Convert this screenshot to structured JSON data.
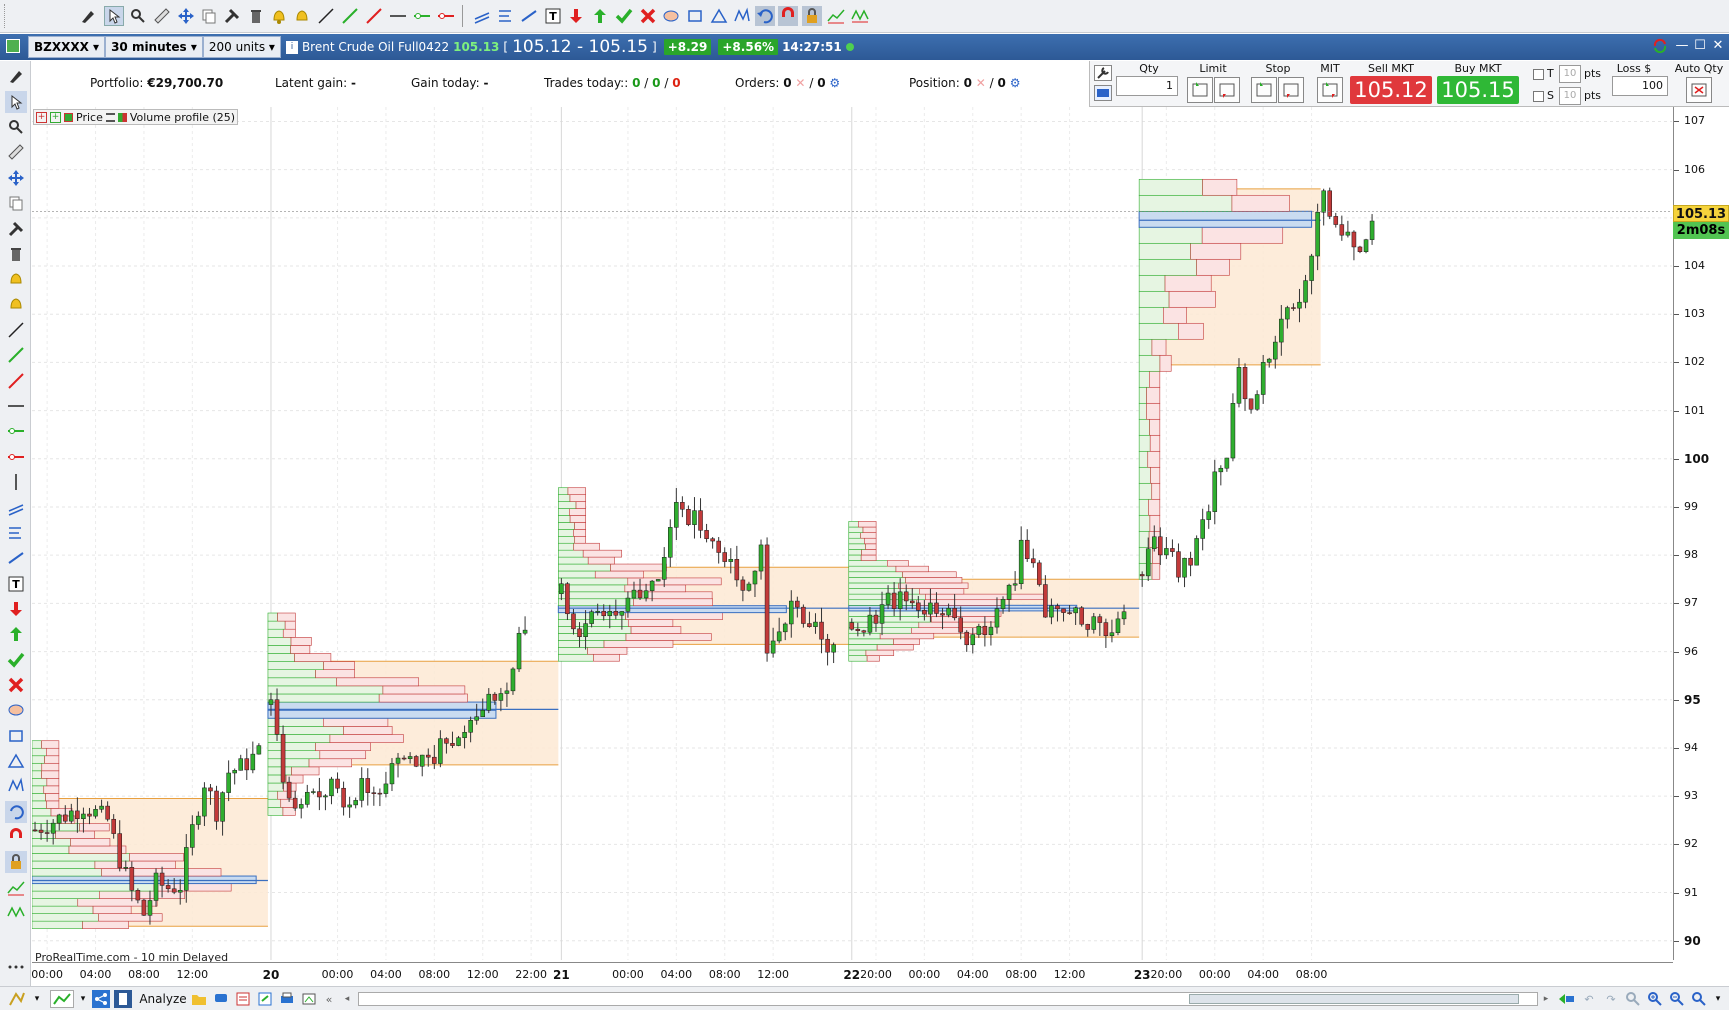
{
  "header": {
    "symbol": "BZXXXX",
    "timeframe": "30 minutes",
    "units": "200 units",
    "instrument": "Brent Crude Oil Full0422",
    "last": "105.13",
    "bracket_open": "[",
    "bid_ask": "105.12 - 105.15",
    "bracket_close": "]",
    "change": "+8.29",
    "change_pct": "+8.56%",
    "time": "14:27:51"
  },
  "portfolio": {
    "portfolio_label": "Portfolio:",
    "portfolio_value": "€29,700.70",
    "latent_label": "Latent gain:",
    "latent_value": "-",
    "gain_label": "Gain today:",
    "gain_value": "-",
    "trades_label": "Trades today::",
    "trades_a": "0",
    "trades_sep1": "/",
    "trades_b": "0",
    "trades_sep2": "/",
    "trades_c": "0",
    "orders_label": "Orders:",
    "orders_a": "0",
    "orders_sep": "/",
    "orders_b": "0",
    "position_label": "Position:",
    "position_a": "0",
    "position_sep": "/",
    "position_b": "0"
  },
  "trade_panel": {
    "qty_label": "Qty",
    "qty_value": "1",
    "limit_label": "Limit",
    "stop_label": "Stop",
    "mit_label": "MIT",
    "sell_label": "Sell MKT",
    "sell_price": "105.12",
    "buy_label": "Buy MKT",
    "buy_price": "105.15",
    "t_label": "T",
    "s_label": "S",
    "t_pts": "10",
    "s_pts": "10",
    "pts_label": "pts",
    "loss_label": "Loss $",
    "loss_value": "100",
    "autoqty_label": "Auto Qty"
  },
  "legend": {
    "price": "Price",
    "volume_profile": "Volume profile (25)"
  },
  "footer_note": "ProRealTime.com - 10 min Delayed",
  "analyze_label": "Analyze",
  "price_tag": "105.13",
  "time_tag": "2m08s",
  "colors": {
    "up": "#2fae2f",
    "down": "#c23a3a",
    "va_fill": "#fde9d4",
    "va_line": "#e8a040",
    "poc": "#3a6fc0",
    "header": "#2d5996"
  },
  "y_axis": {
    "min": 89.6,
    "max": 107.3,
    "labels": [
      "107",
      "106",
      "105",
      "104",
      "103",
      "102",
      "101",
      "100",
      "99",
      "98",
      "97",
      "96",
      "95",
      "94",
      "93",
      "92",
      "91",
      "90"
    ],
    "bold": [
      "100",
      "95",
      "90"
    ]
  },
  "x_axis": {
    "labels": [
      {
        "t": "00:00",
        "i": 2.5
      },
      {
        "t": "04:00",
        "i": 10.5
      },
      {
        "t": "08:00",
        "i": 18.5
      },
      {
        "t": "12:00",
        "i": 26.5
      },
      {
        "t": "20",
        "i": 39.5,
        "b": true
      },
      {
        "t": "00:00",
        "i": 50.5
      },
      {
        "t": "04:00",
        "i": 58.5
      },
      {
        "t": "08:00",
        "i": 66.5
      },
      {
        "t": "12:00",
        "i": 74.5
      },
      {
        "t": "22:00",
        "i": 82.5
      },
      {
        "t": "21",
        "i": 87.5,
        "b": true
      },
      {
        "t": "00:00",
        "i": 98.5
      },
      {
        "t": "04:00",
        "i": 106.5
      },
      {
        "t": "08:00",
        "i": 114.5
      },
      {
        "t": "12:00",
        "i": 122.5
      },
      {
        "t": "22",
        "i": 135.5,
        "b": true
      },
      {
        "t": "20:00",
        "i": 139.5
      },
      {
        "t": "00:00",
        "i": 147.5
      },
      {
        "t": "04:00",
        "i": 155.5
      },
      {
        "t": "08:00",
        "i": 163.5
      },
      {
        "t": "12:00",
        "i": 171.5
      },
      {
        "t": "23",
        "i": 183.5,
        "b": true
      },
      {
        "t": "20:00",
        "i": 187.5
      },
      {
        "t": "00:00",
        "i": 195.5
      },
      {
        "t": "04:00",
        "i": 203.5
      },
      {
        "t": "08:00",
        "i": 211.5
      }
    ]
  },
  "chart_data": {
    "type": "candlestick",
    "sessions": [
      {
        "start": 0,
        "end": 39,
        "poc": 91.25,
        "vah": 92.95,
        "val": 90.3,
        "hi": 94.15,
        "lo": 90.25
      },
      {
        "start": 39,
        "end": 87,
        "poc": 94.8,
        "vah": 95.8,
        "val": 93.65,
        "hi": 96.8,
        "lo": 92.6
      },
      {
        "start": 87,
        "end": 135,
        "poc": 96.9,
        "vah": 97.75,
        "val": 96.15,
        "hi": 99.4,
        "lo": 95.8
      },
      {
        "start": 135,
        "end": 183,
        "poc": 96.9,
        "vah": 97.5,
        "val": 96.3,
        "hi": 98.7,
        "lo": 95.8
      },
      {
        "start": 183,
        "end": 213,
        "poc": 104.95,
        "vah": 105.6,
        "val": 101.95,
        "hi": 105.8,
        "lo": 97.5
      }
    ],
    "segments": [
      {
        "start": 0,
        "pts": [
          [
            0,
            92.3
          ],
          [
            5,
            92.6
          ],
          [
            8,
            92.8
          ],
          [
            12,
            92.5
          ],
          [
            14,
            91.7
          ],
          [
            16,
            91.0
          ],
          [
            18,
            90.55
          ],
          [
            20,
            91.2
          ],
          [
            22,
            91.1
          ],
          [
            24,
            91.15
          ],
          [
            26,
            92.3
          ],
          [
            28,
            93.3
          ],
          [
            30,
            92.7
          ],
          [
            32,
            93.5
          ],
          [
            34,
            93.6
          ],
          [
            36,
            93.8
          ],
          [
            38,
            94.0
          ]
        ]
      },
      {
        "start": 39,
        "pts": [
          [
            39,
            94.9
          ],
          [
            41,
            93.3
          ],
          [
            42,
            92.8
          ],
          [
            44,
            92.75
          ],
          [
            46,
            93.0
          ],
          [
            49,
            93.15
          ],
          [
            52,
            92.85
          ],
          [
            54,
            93.3
          ],
          [
            56,
            92.95
          ],
          [
            57,
            93.2
          ],
          [
            58,
            93.45
          ],
          [
            60,
            93.6
          ],
          [
            62,
            93.75
          ],
          [
            64,
            93.8
          ],
          [
            66,
            93.85
          ],
          [
            68,
            94.1
          ],
          [
            70,
            94.4
          ],
          [
            72,
            94.7
          ],
          [
            74,
            94.9
          ],
          [
            76,
            95.0
          ],
          [
            78,
            95.3
          ],
          [
            80,
            96.2
          ],
          [
            82,
            96.6
          ]
        ]
      },
      {
        "start": 87,
        "pts": [
          [
            87,
            97.2
          ],
          [
            89,
            96.3
          ],
          [
            90,
            96.4
          ],
          [
            92,
            97.0
          ],
          [
            94,
            96.8
          ],
          [
            96,
            96.8
          ],
          [
            98,
            97.1
          ],
          [
            100,
            97.3
          ],
          [
            102,
            97.5
          ],
          [
            104,
            97.8
          ],
          [
            106,
            99.0
          ],
          [
            108,
            98.7
          ],
          [
            110,
            98.7
          ],
          [
            112,
            98.4
          ],
          [
            114,
            98.0
          ],
          [
            116,
            97.6
          ],
          [
            118,
            97.3
          ],
          [
            120,
            98.0
          ],
          [
            121,
            96.0
          ],
          [
            123,
            96.6
          ],
          [
            125,
            96.9
          ],
          [
            127,
            96.8
          ],
          [
            129,
            96.4
          ],
          [
            131,
            96.2
          ],
          [
            133,
            96.3
          ]
        ]
      },
      {
        "start": 135,
        "pts": [
          [
            135,
            96.6
          ],
          [
            137,
            96.5
          ],
          [
            139,
            96.8
          ],
          [
            141,
            97.1
          ],
          [
            143,
            97.1
          ],
          [
            145,
            97.0
          ],
          [
            147,
            96.9
          ],
          [
            150,
            96.9
          ],
          [
            152,
            96.5
          ],
          [
            154,
            96.2
          ],
          [
            156,
            96.4
          ],
          [
            158,
            96.5
          ],
          [
            160,
            96.9
          ],
          [
            162,
            97.5
          ],
          [
            163,
            98.3
          ],
          [
            165,
            98.0
          ],
          [
            167,
            96.9
          ],
          [
            169,
            96.8
          ],
          [
            171,
            96.9
          ],
          [
            173,
            96.7
          ],
          [
            175,
            96.6
          ],
          [
            177,
            96.4
          ],
          [
            179,
            96.8
          ],
          [
            181,
            97.0
          ]
        ]
      },
      {
        "start": 183,
        "pts": [
          [
            183,
            97.6
          ],
          [
            185,
            98.3
          ],
          [
            187,
            98.0
          ],
          [
            189,
            97.7
          ],
          [
            191,
            98.0
          ],
          [
            193,
            98.6
          ],
          [
            195,
            99.6
          ],
          [
            197,
            100.1
          ],
          [
            199,
            101.8
          ],
          [
            201,
            101.1
          ],
          [
            203,
            102.0
          ],
          [
            205,
            102.4
          ],
          [
            207,
            103.0
          ],
          [
            209,
            103.2
          ],
          [
            211,
            104.3
          ],
          [
            213,
            105.7
          ],
          [
            215,
            104.8
          ],
          [
            217,
            104.5
          ],
          [
            219,
            104.3
          ],
          [
            221,
            104.9
          ],
          [
            222,
            105.13
          ]
        ]
      }
    ]
  }
}
